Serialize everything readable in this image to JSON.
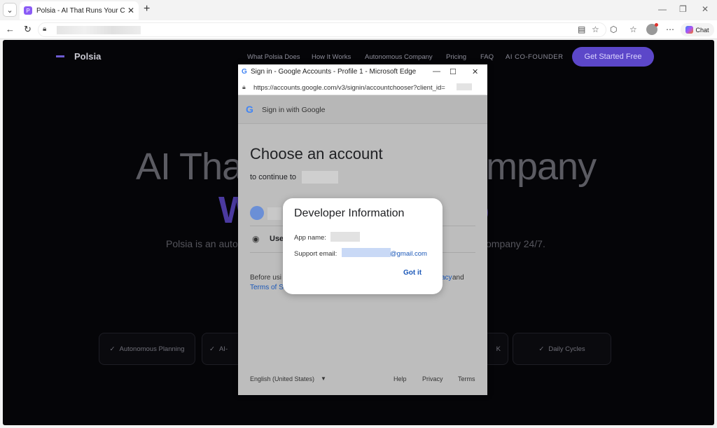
{
  "browser": {
    "tab_title": "Polsia - AI That Runs Your Compan",
    "tab_favicon": "P",
    "new_tab": "+",
    "chat_label": "Chat"
  },
  "site": {
    "logo": "Polsia",
    "nav": [
      "What Polsia Does",
      "How It Works",
      "Autonomous Company",
      "Pricing",
      "FAQ",
      "AI CO-FOUNDER"
    ],
    "cta": "Get Started Free",
    "hero_left": "AI That",
    "hero_right": "mpany",
    "hero_line2_left": "W",
    "hero_line2_right": "o",
    "sub_left": "Polsia is an auto",
    "sub_right": "ompany 24/7.",
    "features": [
      {
        "label": "Autonomous Planning",
        "check": "✓"
      },
      {
        "label": "AI-",
        "check": "✓"
      },
      {
        "label": "K",
        "check": ""
      },
      {
        "label": "Daily Cycles",
        "check": "✓"
      }
    ]
  },
  "popup": {
    "title": "Sign in - Google Accounts - Profile 1 - Microsoft Edge",
    "url": "https://accounts.google.com/v3/signin/accountchooser?client_id=",
    "google_bar": "Sign in with Google",
    "heading": "Choose an account",
    "continue_to": "to continue to",
    "use_another": "Use",
    "before_text": "Before usi",
    "terms_text": "Terms of S",
    "privacy_tail": "acy",
    "and_text": "and",
    "footer_lang": "English (United States)",
    "footer_help": "Help",
    "footer_privacy": "Privacy",
    "footer_terms": "Terms"
  },
  "dialog": {
    "title": "Developer Information",
    "app_name_label": "App name:",
    "support_email_label": "Support email:",
    "email_domain": "@gmail.com",
    "got_it": "Got it"
  },
  "colors": {
    "accent": "#5c47c9",
    "link": "#1a57b8"
  }
}
